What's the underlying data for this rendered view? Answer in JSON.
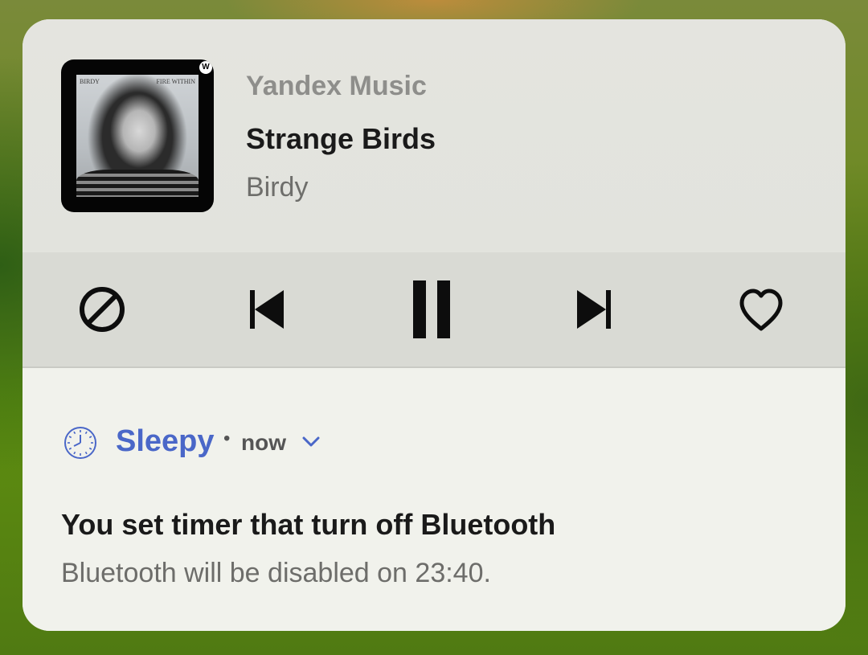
{
  "media": {
    "app_name": "Yandex Music",
    "song_title": "Strange Birds",
    "artist": "Birdy",
    "album_art": {
      "left_text": "BIRDY",
      "right_text": "FIRE WITHIN",
      "logo_letter": "W"
    },
    "controls": {
      "block_icon": "block-icon",
      "previous_icon": "skip-previous-icon",
      "pause_icon": "pause-icon",
      "next_icon": "skip-next-icon",
      "like_icon": "heart-outline-icon"
    }
  },
  "notification": {
    "app_icon": "clock-icon",
    "app_name": "Sleepy",
    "separator": "•",
    "time": "now",
    "expand_icon": "chevron-down-icon",
    "title": "You set timer that turn off Bluetooth",
    "body": "Bluetooth will be disabled on 23:40."
  },
  "colors": {
    "accent": "#4a67c8",
    "title_text": "#1a1a1a",
    "secondary_text": "#6d6d6a",
    "controls_background": "#d9dad4",
    "card_background": "#f1f2ec"
  }
}
